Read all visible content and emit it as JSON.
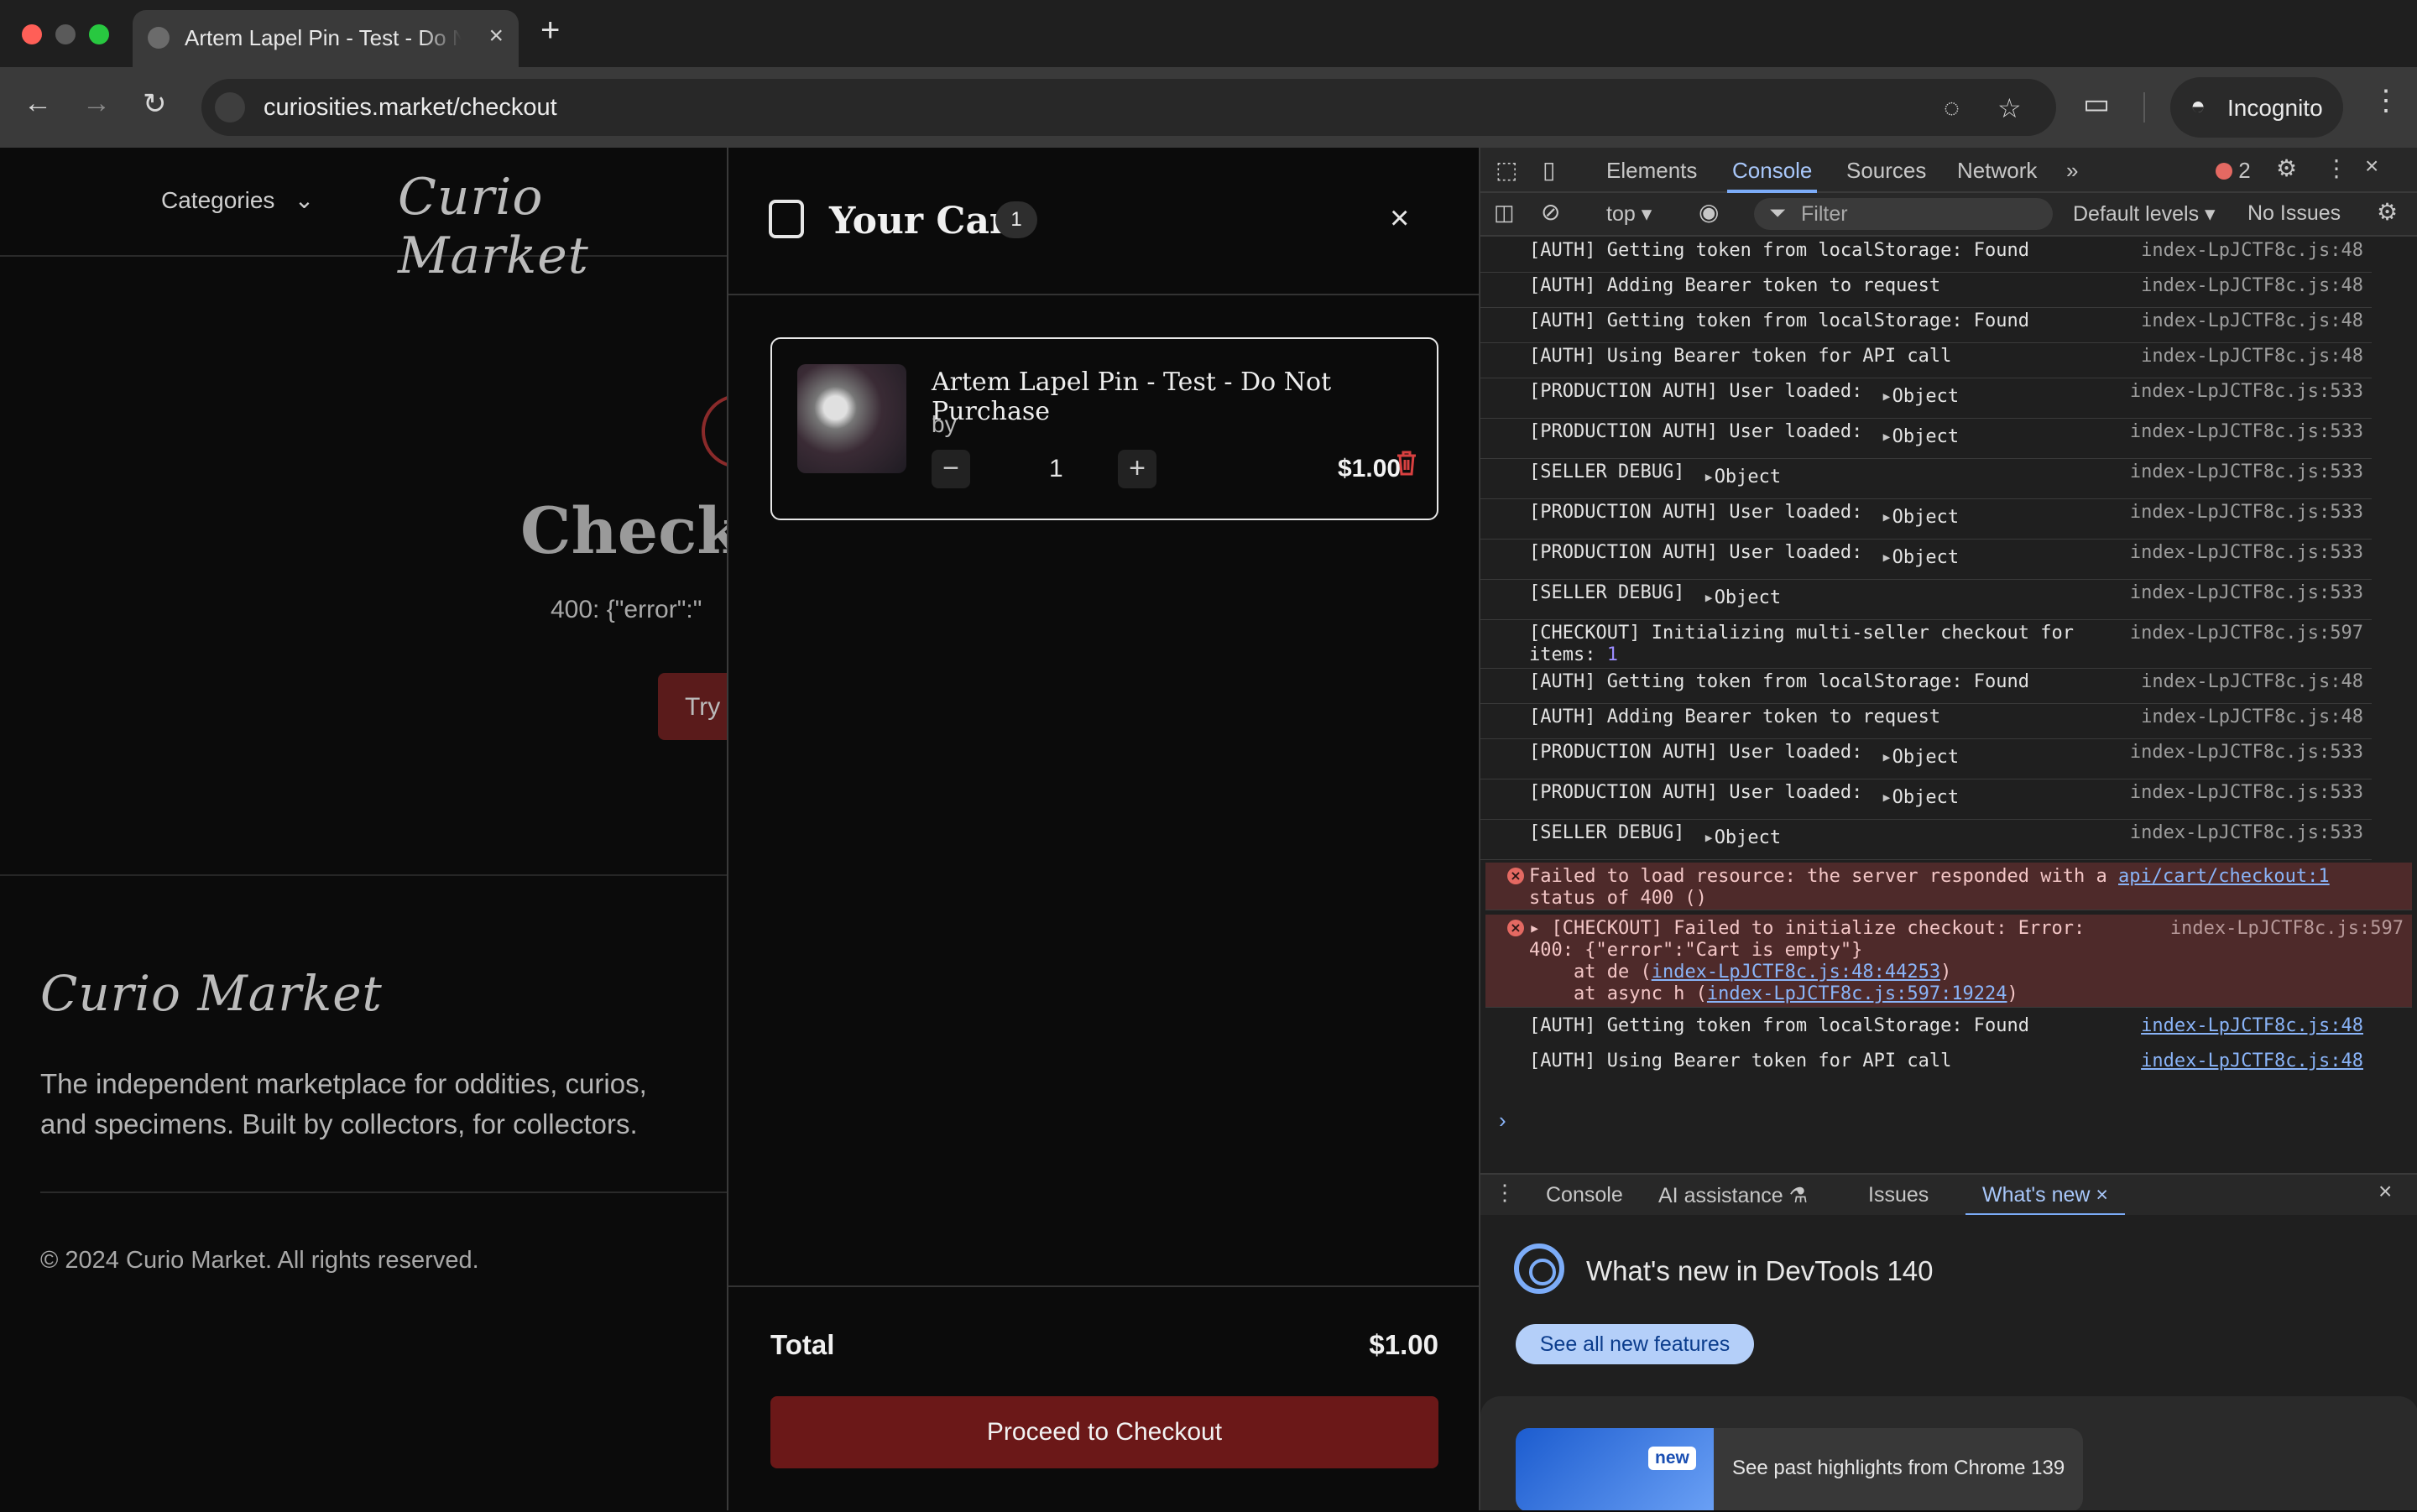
{
  "browser": {
    "tab_title": "Artem Lapel Pin - Test - Do Not Purchase",
    "url": "curiosities.market/checkout",
    "profile_label": "Incognito"
  },
  "page": {
    "nav_categories": "Categories",
    "logo_text": "Curio Market",
    "checkout_title": "Checko",
    "error_text": "400: {\"error\":\"",
    "try_button": "Try",
    "footer_tagline": "The independent marketplace for oddities, curios, and specimens. Built by collectors, for collectors.",
    "copyright": "© 2024 Curio Market. All rights reserved."
  },
  "cart": {
    "title": "Your Cart",
    "count": "1",
    "item": {
      "name": "Artem Lapel Pin - Test - Do Not Purchase",
      "by": "by",
      "quantity": "1",
      "price": "$1.00"
    },
    "total_label": "Total",
    "total_value": "$1.00",
    "checkout_button": "Proceed to Checkout"
  },
  "devtools": {
    "tabs": [
      "Elements",
      "Console",
      "Sources",
      "Network"
    ],
    "error_count": "2",
    "context": "top",
    "filter_placeholder": "Filter",
    "levels": "Default levels",
    "issues": "No Issues",
    "logs": [
      {
        "msg": "[AUTH] Getting token from localStorage: Found",
        "src": "index-LpJCTF8c.js:48"
      },
      {
        "msg": "[AUTH] Adding Bearer token to request",
        "src": "index-LpJCTF8c.js:48"
      },
      {
        "msg": "[AUTH] Getting token from localStorage: Found",
        "src": "index-LpJCTF8c.js:48"
      },
      {
        "msg": "[AUTH] Using Bearer token for API call",
        "src": "index-LpJCTF8c.js:48"
      },
      {
        "msg": "[PRODUCTION AUTH] User loaded:",
        "obj": "Object",
        "src": "index-LpJCTF8c.js:533"
      },
      {
        "msg": "[PRODUCTION AUTH] User loaded:",
        "obj": "Object",
        "src": "index-LpJCTF8c.js:533"
      },
      {
        "msg": "[SELLER DEBUG]",
        "obj": "Object",
        "src": "index-LpJCTF8c.js:533"
      },
      {
        "msg": "[PRODUCTION AUTH] User loaded:",
        "obj": "Object",
        "src": "index-LpJCTF8c.js:533"
      },
      {
        "msg": "[PRODUCTION AUTH] User loaded:",
        "obj": "Object",
        "src": "index-LpJCTF8c.js:533"
      },
      {
        "msg": "[SELLER DEBUG]",
        "obj": "Object",
        "src": "index-LpJCTF8c.js:533"
      },
      {
        "msg": "[CHECKOUT] Initializing multi-seller checkout for",
        "msg2": "items:",
        "num": "1",
        "src": "index-LpJCTF8c.js:597"
      },
      {
        "msg": "[AUTH] Getting token from localStorage: Found",
        "src": "index-LpJCTF8c.js:48"
      },
      {
        "msg": "[AUTH] Adding Bearer token to request",
        "src": "index-LpJCTF8c.js:48"
      },
      {
        "msg": "[PRODUCTION AUTH] User loaded:",
        "obj": "Object",
        "src": "index-LpJCTF8c.js:533"
      },
      {
        "msg": "[PRODUCTION AUTH] User loaded:",
        "obj": "Object",
        "src": "index-LpJCTF8c.js:533"
      },
      {
        "msg": "[SELLER DEBUG]",
        "obj": "Object",
        "src": "index-LpJCTF8c.js:533"
      }
    ],
    "error1": {
      "line1": "Failed to load resource: the server responded with a",
      "link": "api/cart/checkout:1",
      "line2": "status of 400 ()"
    },
    "error2": {
      "line1": "[CHECKOUT] Failed to initialize checkout: Error:",
      "line2": "400: {\"error\":\"Cart is empty\"}",
      "line3_prefix": "    at de (",
      "line3_link": "index-LpJCTF8c.js:48:44253",
      "line4_prefix": "    at async h (",
      "line4_link": "index-LpJCTF8c.js:597:19224",
      "close_paren": ")",
      "src": "index-LpJCTF8c.js:597"
    },
    "tail_logs": [
      {
        "msg": "[AUTH] Getting token from localStorage: Found",
        "src": "index-LpJCTF8c.js:48"
      },
      {
        "msg": "[AUTH] Using Bearer token for API call",
        "src": "index-LpJCTF8c.js:48"
      }
    ],
    "drawer_tabs": [
      "Console",
      "AI assistance",
      "Issues",
      "What's new"
    ],
    "whats_new_title": "What's new in DevTools 140",
    "see_all_button": "See all new features",
    "new_badge": "new",
    "past_highlights": "See past highlights from Chrome 139"
  },
  "colors": {
    "accent": "#6b1818",
    "devtools_accent": "#7cacf8",
    "error_bg": "#4e2a2a"
  }
}
